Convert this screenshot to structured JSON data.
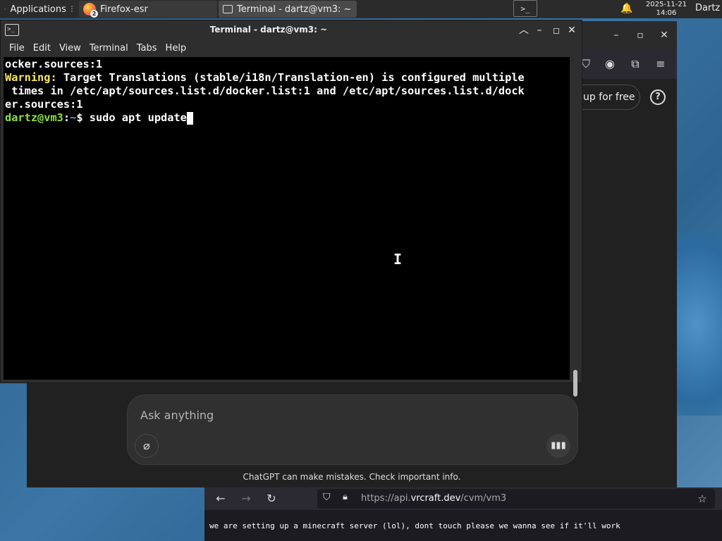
{
  "panel": {
    "applications_label": "Applications",
    "tasks": [
      {
        "label": "Firefox-esr",
        "badge": "2"
      },
      {
        "label": "Terminal - dartz@vm3: ~"
      }
    ],
    "clock_date": "2025-11-21",
    "clock_time": "14:06",
    "user": "Dartz"
  },
  "terminal": {
    "title": "Terminal - dartz@vm3: ~",
    "menu": [
      "File",
      "Edit",
      "View",
      "Terminal",
      "Tabs",
      "Help"
    ],
    "lines": {
      "line1": "ocker.sources:1",
      "warning_label": "Warning:",
      "warning_text": " Target Translations (stable/i18n/Translation-en) is configured multiple",
      "line3": " times in /etc/apt/sources.list.d/docker.list:1 and /etc/apt/sources.list.d/dock",
      "line4": "er.sources:1",
      "prompt_user": "dartz@vm3",
      "prompt_sep": ":",
      "prompt_path": "~",
      "prompt_symbol": "$ ",
      "command": "sudo apt update"
    }
  },
  "chat": {
    "signup_label": "up for free",
    "help_label": "?",
    "ask_placeholder": "Ask anything",
    "disclaimer": "ChatGPT can make mistakes. Check important info."
  },
  "vnc": {
    "url_prefix": "https://api.",
    "url_host": "vrcraft.dev",
    "url_path": "/cvm/vm3",
    "message": "we are setting up a minecraft server (lol), dont touch please we wanna see if it'll work"
  },
  "icons": {
    "apps": "xfce-logo-icon",
    "terminal": "terminal-icon",
    "bell": "notification-bell-icon"
  }
}
